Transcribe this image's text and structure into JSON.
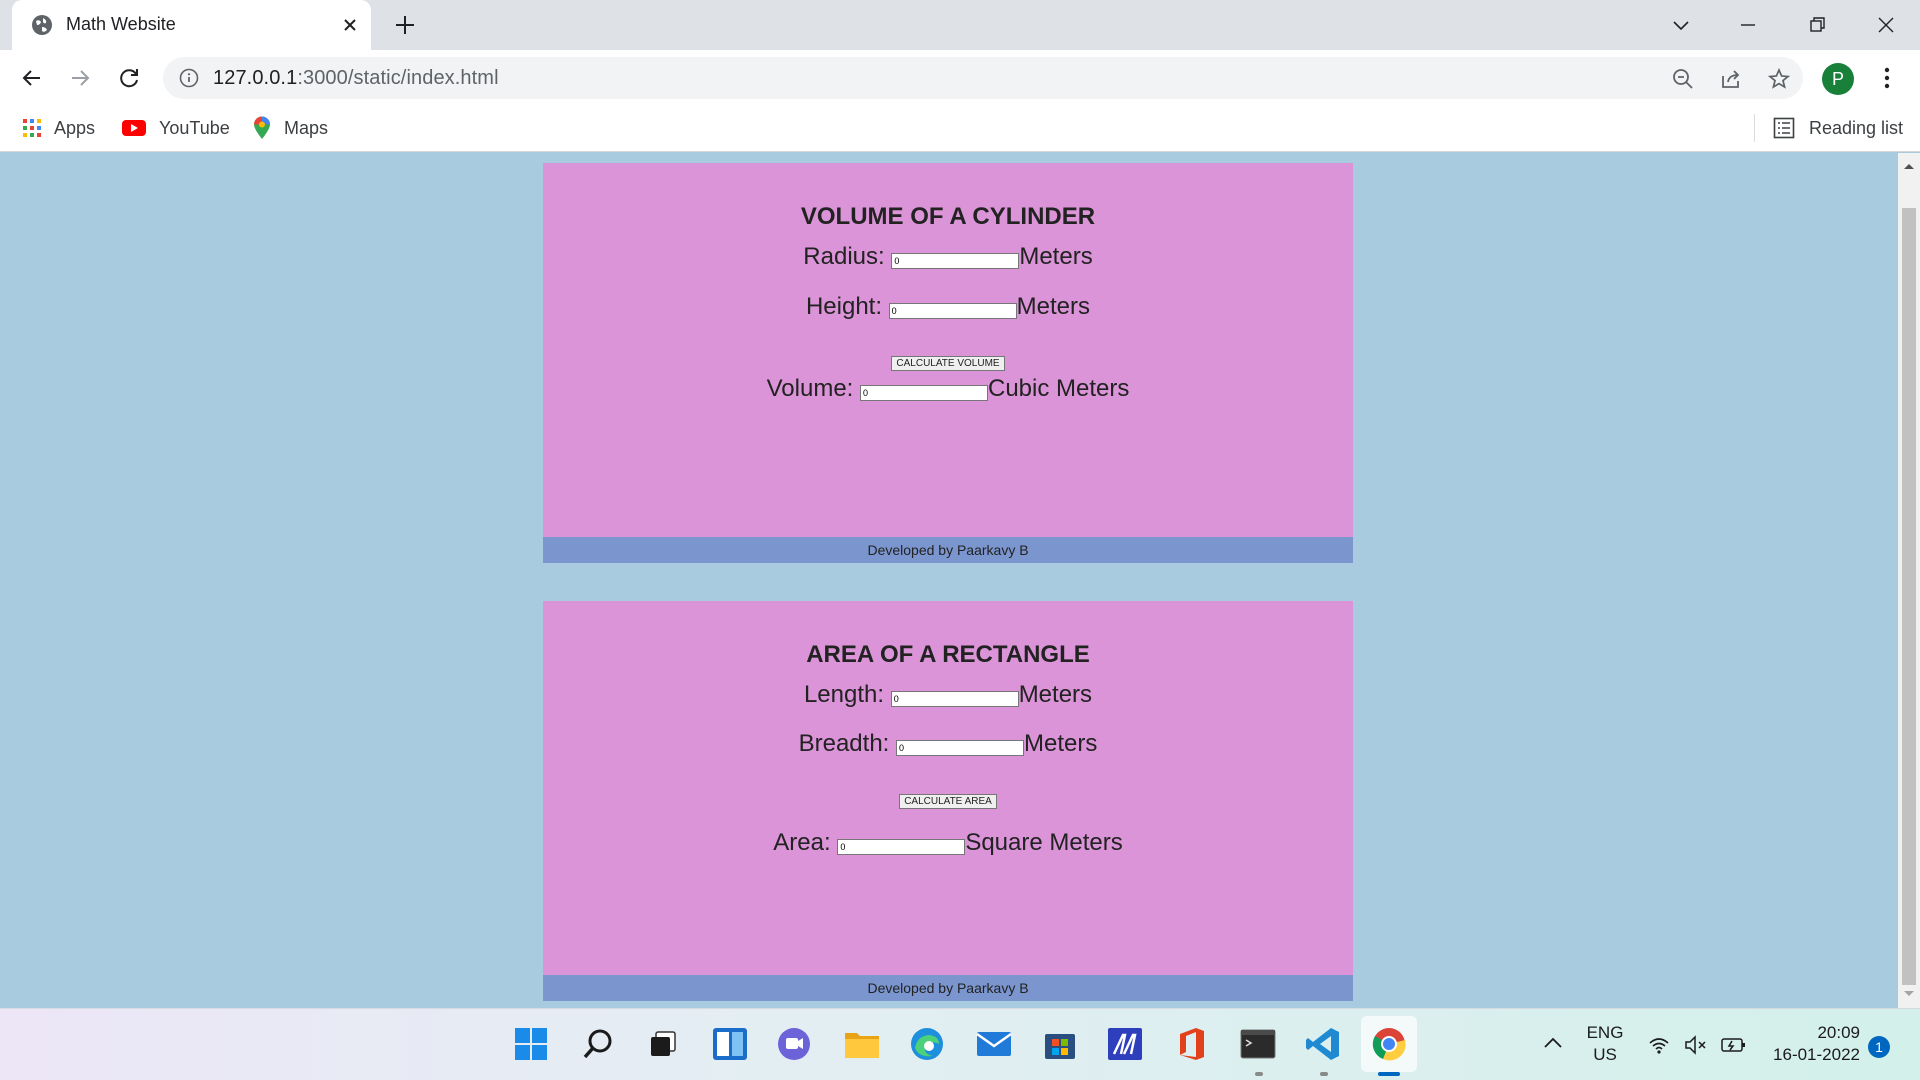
{
  "browser": {
    "tab_title": "Math Website",
    "url_host": "127.0.0.1",
    "url_rest": ":3000/static/index.html",
    "profile_initial": "P",
    "bookmarks": [
      {
        "label": "Apps",
        "icon": "apps-grid-icon"
      },
      {
        "label": "YouTube",
        "icon": "youtube-icon"
      },
      {
        "label": "Maps",
        "icon": "maps-pin-icon"
      }
    ],
    "reading_list": "Reading list"
  },
  "cylinder": {
    "title": "VOLUME OF A CYLINDER",
    "radius_label": "Radius:",
    "radius_value": "0",
    "radius_unit": "Meters",
    "height_label": "Height:",
    "height_value": "0",
    "height_unit": "Meters",
    "button": "CALCULATE VOLUME",
    "volume_label": "Volume:",
    "volume_value": "0",
    "volume_unit": "Cubic Meters",
    "footer": "Developed by Paarkavy B"
  },
  "rectangle": {
    "title": "AREA OF A RECTANGLE",
    "length_label": "Length:",
    "length_value": "0",
    "length_unit": "Meters",
    "breadth_label": "Breadth:",
    "breadth_value": "0",
    "breadth_unit": "Meters",
    "button": "CALCULATE AREA",
    "area_label": "Area:",
    "area_value": "0",
    "area_unit": "Square Meters",
    "footer": "Developed by Paarkavy B"
  },
  "colors": {
    "page_background": "#a9cbe0",
    "card_background": "#da94d7",
    "footer_background": "#7b95cf"
  },
  "taskbar": {
    "lang_top": "ENG",
    "lang_bottom": "US",
    "time": "20:09",
    "date": "16-01-2022",
    "notifications": "1"
  }
}
